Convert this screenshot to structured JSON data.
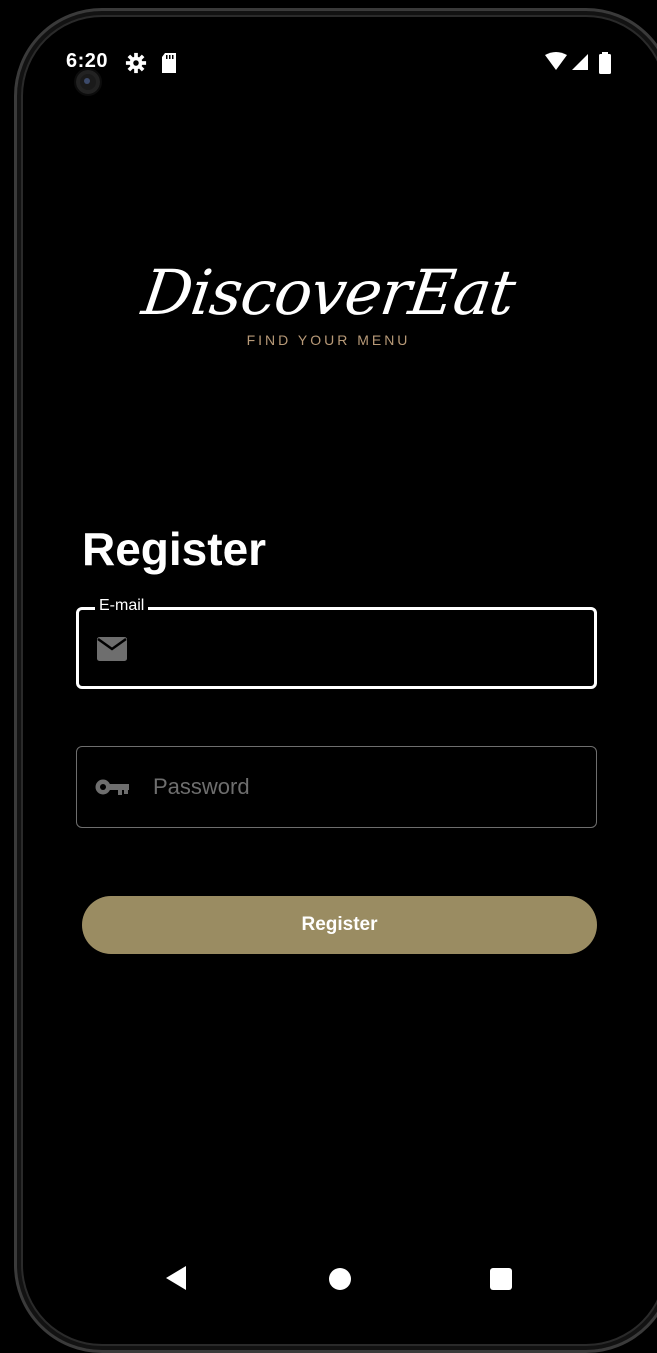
{
  "status_bar": {
    "time": "6:20",
    "icons": [
      "settings-icon",
      "sd-card-icon",
      "wifi-icon",
      "signal-icon",
      "battery-icon"
    ]
  },
  "logo": {
    "name": "DiscoverEat",
    "tagline": "FIND YOUR MENU"
  },
  "page": {
    "title": "Register"
  },
  "form": {
    "email": {
      "label": "E-mail",
      "value": "",
      "icon": "mail-icon"
    },
    "password": {
      "placeholder": "Password",
      "value": "",
      "icon": "key-icon"
    },
    "submit_label": "Register"
  },
  "nav_bar": {
    "buttons": [
      "back-icon",
      "home-icon",
      "recents-icon"
    ]
  },
  "colors": {
    "background": "#000000",
    "accent": "#9a8c62",
    "tagline": "#b89a78",
    "field_border_focused": "#ffffff",
    "field_border": "#6e6e6e"
  }
}
